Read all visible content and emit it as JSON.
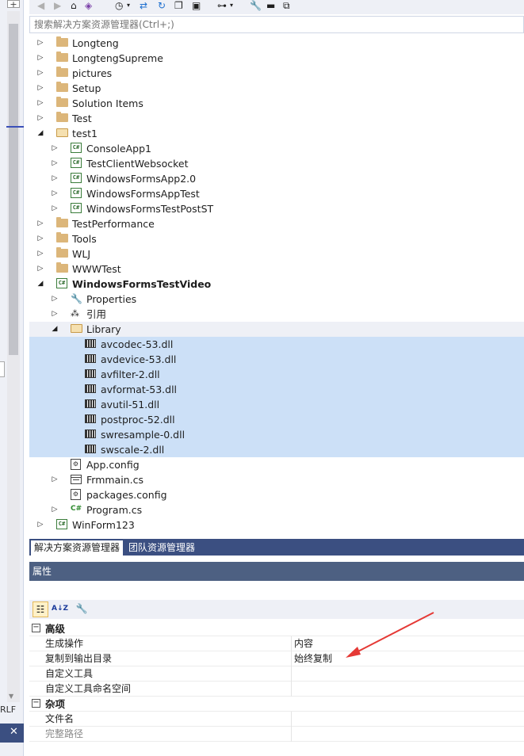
{
  "left": {
    "plus": "+",
    "eol": "RLF",
    "close": "✕"
  },
  "search": {
    "placeholder": "搜索解决方案资源管理器(Ctrl+;)"
  },
  "tree": [
    {
      "label": "Longteng",
      "icon": "folder-icon",
      "depth": 0,
      "arrow": "collapsed"
    },
    {
      "label": "LongtengSupreme",
      "icon": "folder-icon",
      "depth": 0,
      "arrow": "collapsed"
    },
    {
      "label": "pictures",
      "icon": "folder-icon",
      "depth": 0,
      "arrow": "collapsed"
    },
    {
      "label": "Setup",
      "icon": "folder-icon",
      "depth": 0,
      "arrow": "collapsed"
    },
    {
      "label": "Solution Items",
      "icon": "folder-icon",
      "depth": 0,
      "arrow": "collapsed"
    },
    {
      "label": "Test",
      "icon": "folder-icon",
      "depth": 0,
      "arrow": "collapsed"
    },
    {
      "label": "test1",
      "icon": "folder-open-icon",
      "depth": 0,
      "arrow": "expanded"
    },
    {
      "label": "ConsoleApp1",
      "icon": "csharp-project-icon",
      "depth": 1,
      "arrow": "collapsed"
    },
    {
      "label": "TestClientWebsocket",
      "icon": "csharp-project-icon",
      "depth": 1,
      "arrow": "collapsed"
    },
    {
      "label": "WindowsFormsApp2.0",
      "icon": "csharp-project-icon",
      "depth": 1,
      "arrow": "collapsed"
    },
    {
      "label": "WindowsFormsAppTest",
      "icon": "csharp-project-icon",
      "depth": 1,
      "arrow": "collapsed"
    },
    {
      "label": "WindowsFormsTestPostST",
      "icon": "csharp-project-icon",
      "depth": 1,
      "arrow": "collapsed"
    },
    {
      "label": "TestPerformance",
      "icon": "folder-icon",
      "depth": 0,
      "arrow": "collapsed"
    },
    {
      "label": "Tools",
      "icon": "folder-icon",
      "depth": 0,
      "arrow": "collapsed"
    },
    {
      "label": "WLJ",
      "icon": "folder-icon",
      "depth": 0,
      "arrow": "collapsed"
    },
    {
      "label": "WWWTest",
      "icon": "folder-icon",
      "depth": 0,
      "arrow": "collapsed"
    },
    {
      "label": "WindowsFormsTestVideo",
      "icon": "csharp-project-icon",
      "depth": 0,
      "arrow": "expanded",
      "bold": true
    },
    {
      "label": "Properties",
      "icon": "wrench-icon",
      "depth": 1,
      "arrow": "collapsed"
    },
    {
      "label": "引用",
      "icon": "references-icon",
      "depth": 1,
      "arrow": "collapsed"
    },
    {
      "label": "Library",
      "icon": "folder-open-icon",
      "depth": 1,
      "arrow": "expanded",
      "selected": "light"
    },
    {
      "label": "avcodec-53.dll",
      "icon": "dll-icon",
      "depth": 2,
      "arrow": "none",
      "selected": "blue"
    },
    {
      "label": "avdevice-53.dll",
      "icon": "dll-icon",
      "depth": 2,
      "arrow": "none",
      "selected": "blue"
    },
    {
      "label": "avfilter-2.dll",
      "icon": "dll-icon",
      "depth": 2,
      "arrow": "none",
      "selected": "blue"
    },
    {
      "label": "avformat-53.dll",
      "icon": "dll-icon",
      "depth": 2,
      "arrow": "none",
      "selected": "blue"
    },
    {
      "label": "avutil-51.dll",
      "icon": "dll-icon",
      "depth": 2,
      "arrow": "none",
      "selected": "blue"
    },
    {
      "label": "postproc-52.dll",
      "icon": "dll-icon",
      "depth": 2,
      "arrow": "none",
      "selected": "blue"
    },
    {
      "label": "swresample-0.dll",
      "icon": "dll-icon",
      "depth": 2,
      "arrow": "none",
      "selected": "blue"
    },
    {
      "label": "swscale-2.dll",
      "icon": "dll-icon",
      "depth": 2,
      "arrow": "none",
      "selected": "blue"
    },
    {
      "label": "App.config",
      "icon": "config-file-icon",
      "depth": 1,
      "arrow": "none"
    },
    {
      "label": "Frmmain.cs",
      "icon": "form-icon",
      "depth": 1,
      "arrow": "collapsed"
    },
    {
      "label": "packages.config",
      "icon": "config-file-icon",
      "depth": 1,
      "arrow": "none"
    },
    {
      "label": "Program.cs",
      "icon": "csharp-file-icon",
      "depth": 1,
      "arrow": "collapsed"
    },
    {
      "label": "WinForm123",
      "icon": "csharp-project-icon",
      "depth": 0,
      "arrow": "collapsed"
    }
  ],
  "tabs": {
    "solution": "解决方案资源管理器",
    "team": "团队资源管理器"
  },
  "properties": {
    "title": "属性",
    "categories": [
      {
        "name": "高级",
        "rows": [
          {
            "name": "生成操作",
            "value": "内容"
          },
          {
            "name": "复制到输出目录",
            "value": "始终复制"
          },
          {
            "name": "自定义工具",
            "value": ""
          },
          {
            "name": "自定义工具命名空间",
            "value": ""
          }
        ]
      },
      {
        "name": "杂项",
        "rows": [
          {
            "name": "文件名",
            "value": ""
          },
          {
            "name": "完整路径",
            "value": "",
            "gray": true
          }
        ]
      }
    ]
  },
  "colors": {
    "selection": "#cce0f7",
    "tab_bar": "#3b4f81",
    "annotation_arrow": "#e53935"
  }
}
